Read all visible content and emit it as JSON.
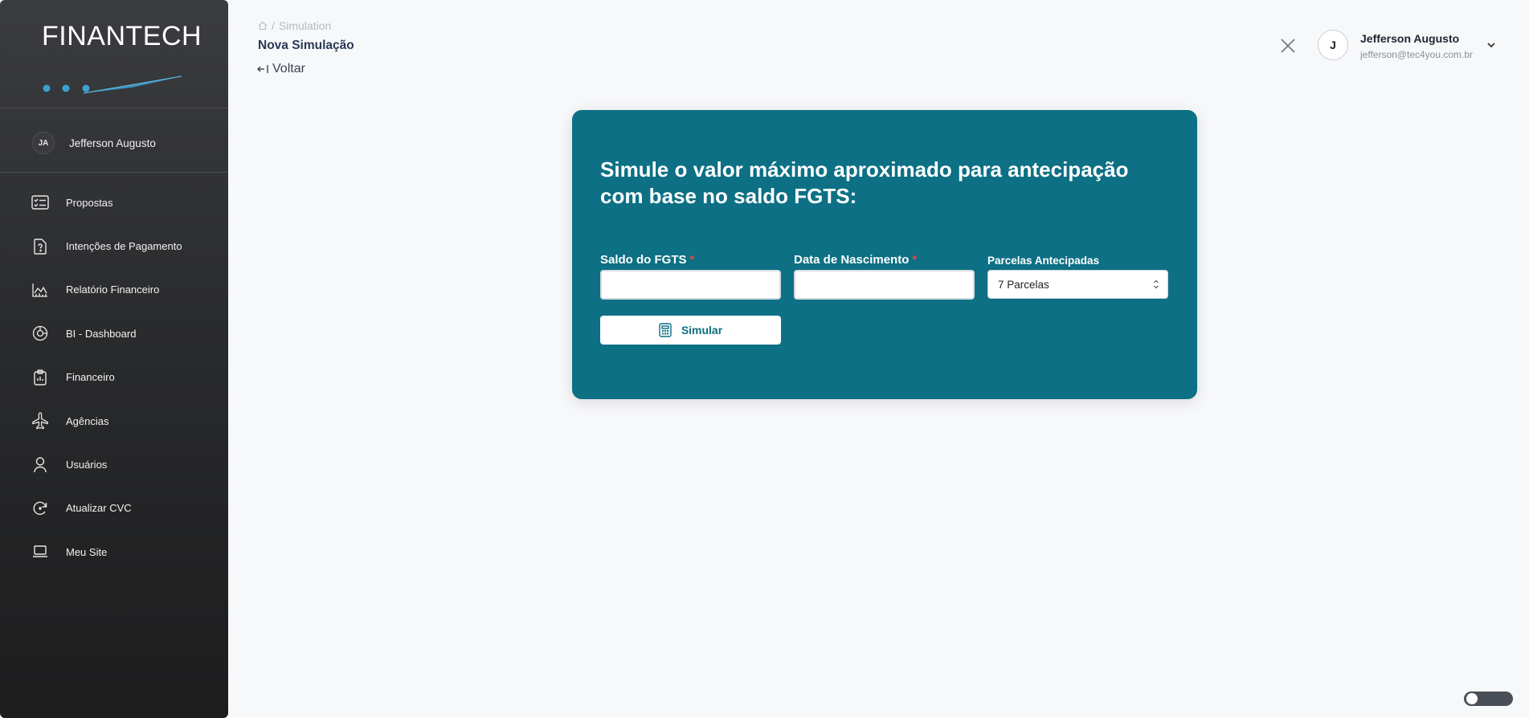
{
  "brand": {
    "logo_text": "FINANTECH"
  },
  "sidebar": {
    "user": {
      "initials": "JA",
      "name": "Jefferson Augusto"
    },
    "items": [
      {
        "label": "Propostas",
        "icon": "proposal-list-icon"
      },
      {
        "label": "Intenções de Pagamento",
        "icon": "document-question-icon"
      },
      {
        "label": "Relatório Financeiro",
        "icon": "line-chart-icon"
      },
      {
        "label": "BI - Dashboard",
        "icon": "target-dashboard-icon"
      },
      {
        "label": "Financeiro",
        "icon": "clipboard-icon"
      },
      {
        "label": "Agências",
        "icon": "airplane-icon"
      },
      {
        "label": "Usuários",
        "icon": "user-icon"
      },
      {
        "label": "Atualizar CVC",
        "icon": "refresh-icon"
      },
      {
        "label": "Meu Site",
        "icon": "laptop-icon"
      }
    ]
  },
  "header": {
    "breadcrumb": {
      "separator": "/",
      "current": "Simulation"
    },
    "title": "Nova Simulação",
    "back_label": "Voltar",
    "user": {
      "initial": "J",
      "name": "Jefferson Augusto",
      "email": "jefferson@tec4you.com.br"
    }
  },
  "form": {
    "heading": "Simule o valor máximo aproximado para antecipação com base no saldo FGTS:",
    "saldo": {
      "label": "Saldo do FGTS",
      "required_mark": "*",
      "value": ""
    },
    "nascimento": {
      "label": "Data de Nascimento",
      "required_mark": "*",
      "value": ""
    },
    "parcelas": {
      "label": "Parcelas Antecipadas",
      "selected": "7 Parcelas"
    },
    "submit_label": "Simular"
  },
  "colors": {
    "accent": "#0d7084",
    "sidebar_top": "#3b3c3f",
    "sidebar_bottom": "#1d1d1e",
    "logo_dots": "#3d9fd1"
  }
}
